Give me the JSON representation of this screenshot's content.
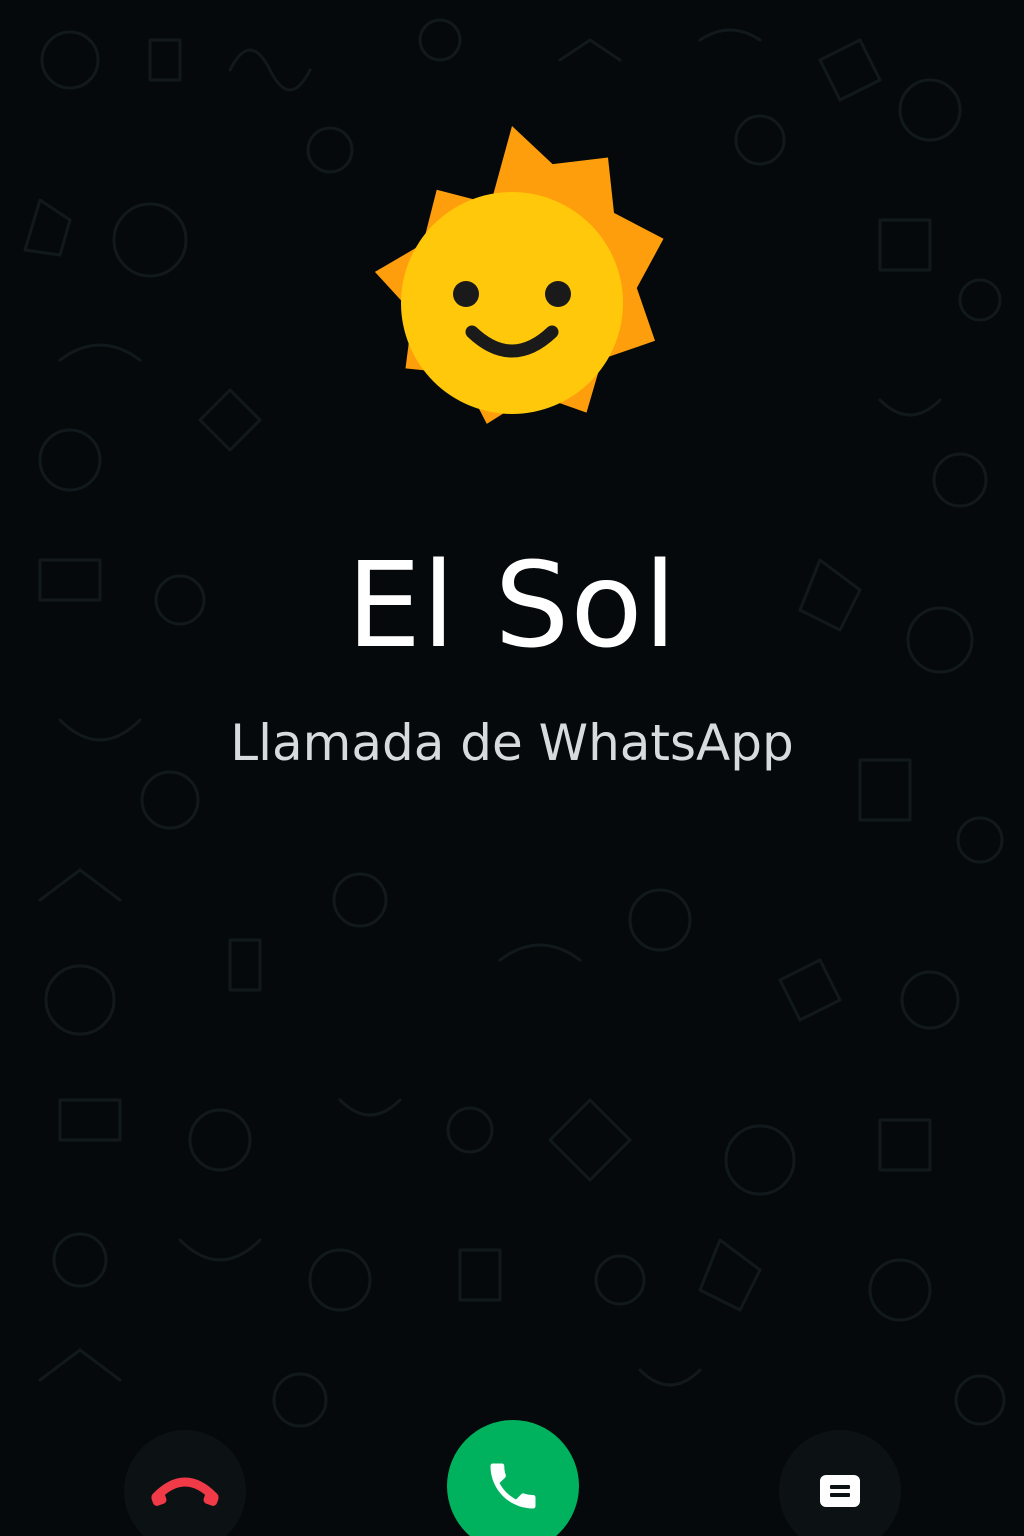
{
  "caller": {
    "name": "El Sol",
    "call_type": "Llamada de WhatsApp",
    "avatar_icon": "smiling-sun-icon"
  },
  "actions": {
    "decline": {
      "icon": "phone-hangup-icon",
      "color": "#f03a47"
    },
    "accept": {
      "icon": "phone-icon",
      "color": "#00b25e"
    },
    "message": {
      "icon": "message-icon",
      "color": "#ffffff"
    }
  },
  "colors": {
    "background": "#05090b",
    "sun_rays": "#ff9e0c",
    "sun_face": "#ffc80a",
    "sun_features": "#1a1a1a"
  }
}
